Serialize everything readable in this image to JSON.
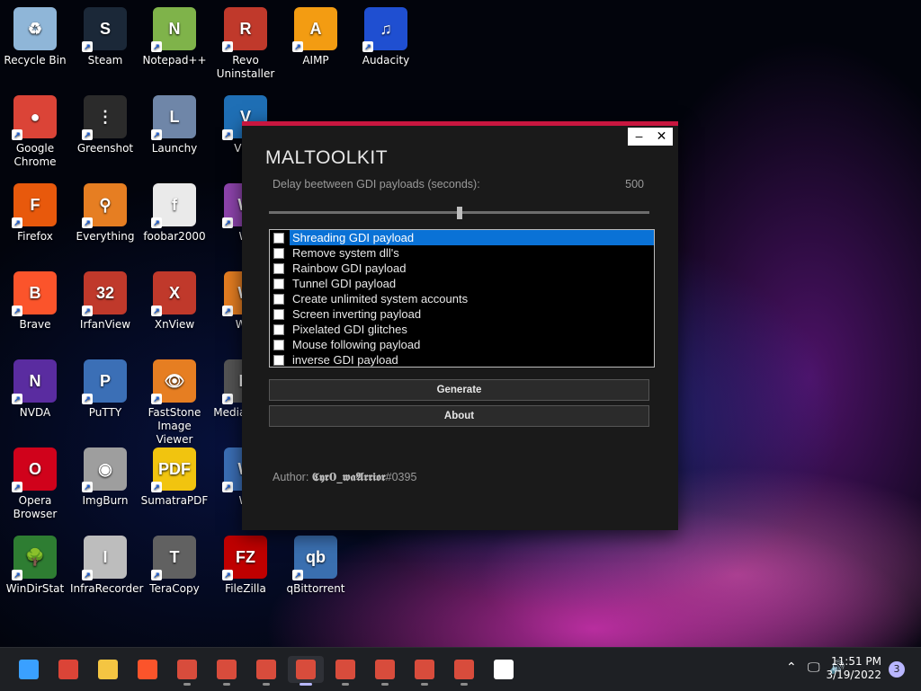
{
  "desktop": {
    "icons": [
      {
        "label": "Recycle Bin",
        "icon": "recycle-bin-icon",
        "color": "#8fb6d8",
        "glyph": "♻"
      },
      {
        "label": "Steam",
        "icon": "steam-icon",
        "color": "#1b2838",
        "glyph": "S"
      },
      {
        "label": "Notepad++",
        "icon": "notepadpp-icon",
        "color": "#7fb34a",
        "glyph": "N"
      },
      {
        "label": "Revo Uninstaller",
        "icon": "revo-uninstaller-icon",
        "color": "#c0392b",
        "glyph": "R"
      },
      {
        "label": "AIMP",
        "icon": "aimp-icon",
        "color": "#f39c12",
        "glyph": "A"
      },
      {
        "label": "Audacity",
        "icon": "audacity-icon",
        "color": "#1f4fd1",
        "glyph": "♫"
      },
      {
        "label": "Google Chrome",
        "icon": "chrome-icon",
        "color": "#db4437",
        "glyph": "●"
      },
      {
        "label": "Greenshot",
        "icon": "greenshot-icon",
        "color": "#2b2b2b",
        "glyph": "⋮"
      },
      {
        "label": "Launchy",
        "icon": "launchy-icon",
        "color": "#6f86a8",
        "glyph": "L"
      },
      {
        "label": "VNC",
        "icon": "vnc-icon",
        "color": "#1f6fb5",
        "glyph": "V"
      },
      {
        "label": "Firefox",
        "icon": "firefox-icon",
        "color": "#e8590c",
        "glyph": "F"
      },
      {
        "label": "Everything",
        "icon": "everything-icon",
        "color": "#e67e22",
        "glyph": "⚲"
      },
      {
        "label": "foobar2000",
        "icon": "foobar2000-icon",
        "color": "#eaeaea",
        "glyph": "f"
      },
      {
        "label": "Wi",
        "icon": "winrar-icon",
        "color": "#8e44ad",
        "glyph": "W"
      },
      {
        "label": "Brave",
        "icon": "brave-icon",
        "color": "#fb542b",
        "glyph": "B"
      },
      {
        "label": "IrfanView",
        "icon": "irfanview-icon",
        "color": "#c0392b",
        "glyph": "32"
      },
      {
        "label": "XnView",
        "icon": "xnview-icon",
        "color": "#c0392b",
        "glyph": "X"
      },
      {
        "label": "Win",
        "icon": "winscp-icon",
        "color": "#e67e22",
        "glyph": "W"
      },
      {
        "label": "NVDA",
        "icon": "nvda-icon",
        "color": "#5a2ca0",
        "glyph": "N"
      },
      {
        "label": "PuTTY",
        "icon": "putty-icon",
        "color": "#3b6fb6",
        "glyph": "P"
      },
      {
        "label": "FastStone Image Viewer",
        "icon": "faststone-icon",
        "color": "#e67e22",
        "glyph": "👁"
      },
      {
        "label": "Media Class",
        "icon": "media-classic-icon",
        "color": "#555555",
        "glyph": "M"
      },
      {
        "label": "Opera Browser",
        "icon": "opera-icon",
        "color": "#d0021b",
        "glyph": "O"
      },
      {
        "label": "ImgBurn",
        "icon": "imgburn-icon",
        "color": "#9e9e9e",
        "glyph": "◉"
      },
      {
        "label": "SumatraPDF",
        "icon": "sumatrapdf-icon",
        "color": "#f1c40f",
        "glyph": "PDF"
      },
      {
        "label": "Wi",
        "icon": "windirstat2-icon",
        "color": "#3b6fb6",
        "glyph": "W"
      },
      {
        "label": "WinDirStat",
        "icon": "windirstat-icon",
        "color": "#2e7d32",
        "glyph": "🌳"
      },
      {
        "label": "InfraRecorder",
        "icon": "infrarecorder-icon",
        "color": "#bdbdbd",
        "glyph": "I"
      },
      {
        "label": "TeraCopy",
        "icon": "teracopy-icon",
        "color": "#616161",
        "glyph": "T"
      },
      {
        "label": "FileZilla",
        "icon": "filezilla-icon",
        "color": "#bf0000",
        "glyph": "FZ"
      },
      {
        "label": "qBittorrent",
        "icon": "qbittorrent-icon",
        "color": "#3a6fb0",
        "glyph": "qb"
      }
    ]
  },
  "window": {
    "title": "MALTOOLKIT",
    "minimize": "–",
    "close": "✕",
    "accent": "#c8163f",
    "delay_label": "Delay beetween GDI payloads (seconds):",
    "delay_value": "500",
    "slider_fraction": 0.5,
    "payloads": [
      "Shreading GDI payload",
      "Remove system dll's",
      "Rainbow GDI payload",
      "Tunnel GDI payload",
      "Create unlimited system accounts",
      "Screen inverting payload",
      "Pixelated GDI glitches",
      "Mouse following payload",
      "inverse GDI payload"
    ],
    "selected_index": 0,
    "generate_label": "Generate",
    "about_label": "About",
    "author_prefix": "Author: ",
    "author_name": "𝕮𝖞𝖗0_𝖜𝖆𝕬𝖗𝖗𝖎𝖔𝖗",
    "author_suffix": "#0395"
  },
  "taskbar": {
    "items": [
      {
        "icon": "start-icon",
        "color": "#3aa0ff"
      },
      {
        "icon": "chrome-taskbar-icon",
        "color": "#db4437"
      },
      {
        "icon": "file-explorer-icon",
        "color": "#f4c542"
      },
      {
        "icon": "brave-taskbar-icon",
        "color": "#fb542b"
      },
      {
        "icon": "app-window-icon-1",
        "color": "#d84c3c"
      },
      {
        "icon": "app-window-icon-2",
        "color": "#d84c3c"
      },
      {
        "icon": "app-window-icon-3",
        "color": "#d84c3c"
      },
      {
        "icon": "app-window-icon-4",
        "color": "#d84c3c"
      },
      {
        "icon": "app-window-icon-5",
        "color": "#d84c3c"
      },
      {
        "icon": "app-window-icon-6",
        "color": "#d84c3c"
      },
      {
        "icon": "app-window-icon-7",
        "color": "#d84c3c"
      },
      {
        "icon": "app-window-icon-8",
        "color": "#d84c3c"
      },
      {
        "icon": "calendar-app-icon",
        "color": "#ffffff"
      }
    ],
    "active_index": 7,
    "time": "11:51 PM",
    "date": "3/19/2022",
    "notification_count": "3"
  }
}
